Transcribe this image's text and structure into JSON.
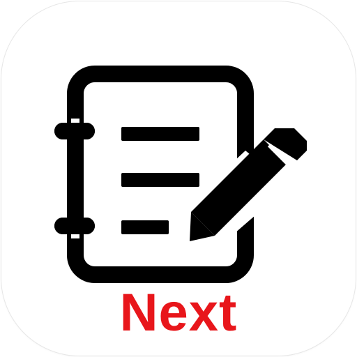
{
  "app_icon": {
    "label": "Next",
    "label_color": "#e8161b",
    "glyph_color": "#000000",
    "background_color": "#ffffff",
    "icon": "notebook-with-pencil-icon"
  }
}
